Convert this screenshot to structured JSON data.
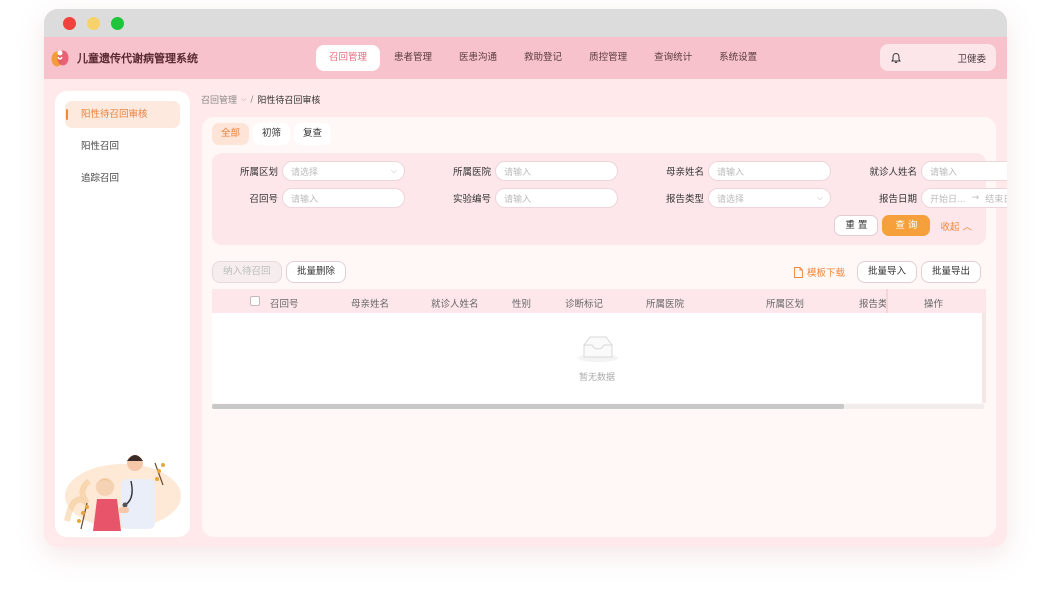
{
  "app": {
    "title": "儿童遗传代谢病管理系统",
    "user": "卫健委"
  },
  "menu": [
    {
      "label": "召回管理",
      "active": true
    },
    {
      "label": "患者管理"
    },
    {
      "label": "医患沟通"
    },
    {
      "label": "救助登记"
    },
    {
      "label": "质控管理"
    },
    {
      "label": "查询统计"
    },
    {
      "label": "系统设置"
    }
  ],
  "sidebar": {
    "items": [
      {
        "label": "阳性待召回审核",
        "active": true
      },
      {
        "label": "阳性召回"
      },
      {
        "label": "追踪召回"
      }
    ]
  },
  "breadcrumb": {
    "parent": "召回管理",
    "separator": "/",
    "current": "阳性待召回审核"
  },
  "tabs": [
    {
      "label": "全部",
      "active": true
    },
    {
      "label": "初筛"
    },
    {
      "label": "复查"
    }
  ],
  "filters": {
    "row1": [
      {
        "label": "所属区划",
        "placeholder": "请选择",
        "type": "select"
      },
      {
        "label": "所属医院",
        "placeholder": "请输入"
      },
      {
        "label": "母亲姓名",
        "placeholder": "请输入"
      },
      {
        "label": "就诊人姓名",
        "placeholder": "请输入"
      }
    ],
    "row2": [
      {
        "label": "召回号",
        "placeholder": "请输入"
      },
      {
        "label": "实验编号",
        "placeholder": "请输入"
      },
      {
        "label": "报告类型",
        "placeholder": "请选择",
        "type": "select"
      },
      {
        "label": "报告日期",
        "start": "开始日...",
        "arrow": "→",
        "end": "结束日..."
      }
    ],
    "reset": "重 置",
    "query": "查 询",
    "collapse": "收起"
  },
  "actions": {
    "add_recall": "纳入待召回",
    "batch_delete": "批量删除",
    "template_download": "模板下载",
    "batch_import": "批量导入",
    "batch_export": "批量导出"
  },
  "table": {
    "columns": [
      "召回号",
      "母亲姓名",
      "就诊人姓名",
      "性别",
      "诊断标记",
      "所属医院",
      "所属区划",
      "报告类",
      "操作"
    ],
    "empty_text": "暂无数据"
  },
  "colors": {
    "accent": "#f5a03a",
    "nav": "#f7c2cb",
    "active_text": "#e86b7c",
    "background": "#ffe9ea"
  }
}
